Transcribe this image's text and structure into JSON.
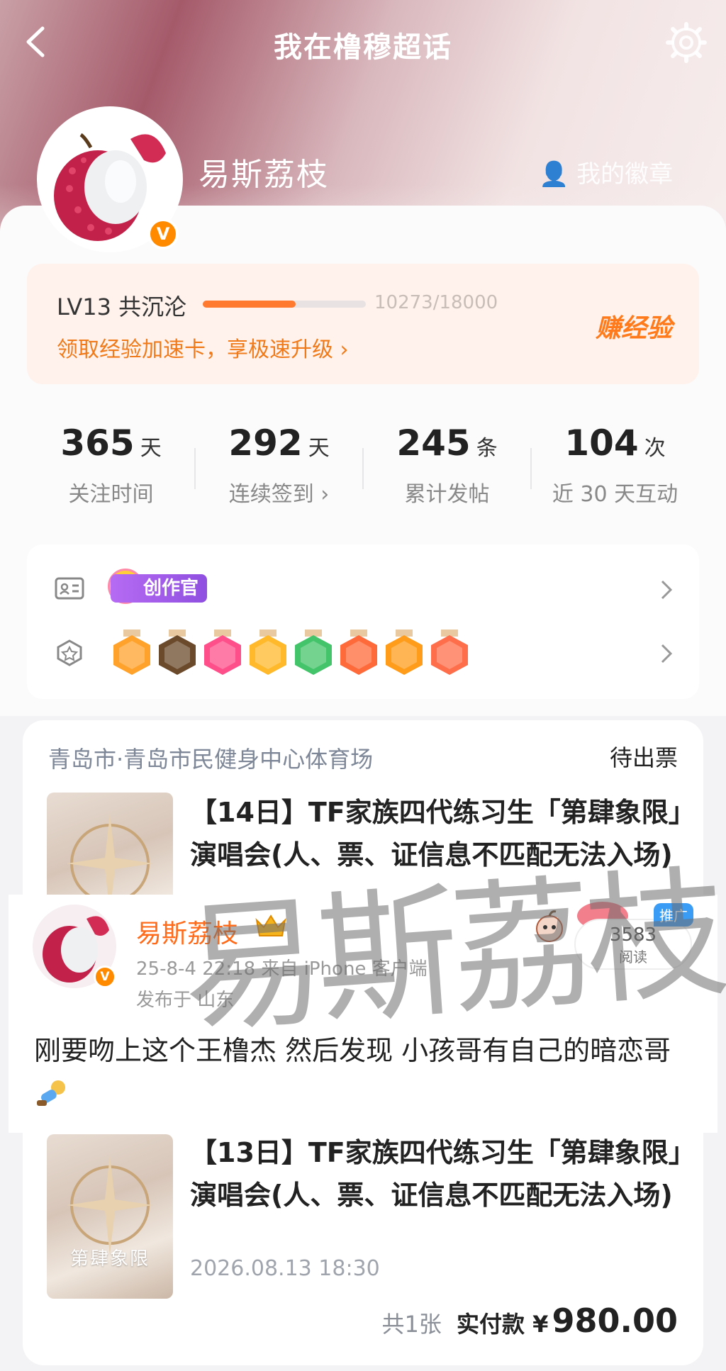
{
  "header": {
    "title": "我在橹穆超话",
    "username": "易斯荔枝",
    "my_badge": "我的徽章",
    "verified_mark": "V"
  },
  "level": {
    "label": "LV13 共沉沦",
    "progress_text": "10273/18000",
    "progress_fraction": 0.571,
    "boost_link": "领取经验加速卡，享极速升级",
    "earn_button": "赚经验"
  },
  "stats": [
    {
      "value": "365",
      "unit": "天",
      "label": "关注时间"
    },
    {
      "value": "292",
      "unit": "天",
      "label": "连续签到 ›"
    },
    {
      "value": "245",
      "unit": "条",
      "label": "累计发帖"
    },
    {
      "value": "104",
      "unit": "次",
      "label": "近 30 天互动"
    }
  ],
  "badges": {
    "creator_tag": "创作官",
    "medals": [
      {
        "icon": "crown-medal-icon",
        "color": "#ffa22b"
      },
      {
        "icon": "super-medal-icon",
        "color": "#6b4a2b"
      },
      {
        "icon": "lv13-medal-icon",
        "color": "#ff4f8a"
      },
      {
        "icon": "hi-medal-icon",
        "color": "#ffb92b"
      },
      {
        "icon": "hand-medal-icon",
        "color": "#44c46a"
      },
      {
        "icon": "100-days-medal-icon",
        "color": "#ff6a3a"
      },
      {
        "icon": "30-days-medal-icon",
        "color": "#ff9c1a"
      },
      {
        "icon": "rock-hand-medal-icon",
        "color": "#ff6e4a"
      }
    ]
  },
  "order": {
    "venue": "青岛市·青岛市民健身中心体育场",
    "status": "待出票",
    "items": [
      {
        "title": "【14日】TF家族四代练习生「第肆象限」演唱会(人、票、证信息不匹配无法入场)",
        "date": ""
      },
      {
        "title": "【13日】TF家族四代练习生「第肆象限」演唱会(人、票、证信息不匹配无法入场)",
        "date": "2026.08.13 18:30"
      }
    ],
    "poster_caption": "第肆象限",
    "quantity": "共1张",
    "paid_label": "实付款",
    "currency": "¥",
    "amount": "980.00"
  },
  "post": {
    "author": "易斯荔枝",
    "time_source": "25-8-4 22:18  来自 iPhone 客户端",
    "location": "发布于 山东",
    "reads": "3583",
    "reads_label": "阅读",
    "promo_tag": "推广",
    "text": "刚要吻上这个王橹杰 然后发现 小孩哥有自己的暗恋哥"
  },
  "watermark": "易斯荔枝",
  "colors": {
    "accent_orange": "#ff7a2e",
    "link_orange": "#f07a1a",
    "creator_purple": "#9b55e8",
    "promo_blue": "#3a9cf5"
  }
}
